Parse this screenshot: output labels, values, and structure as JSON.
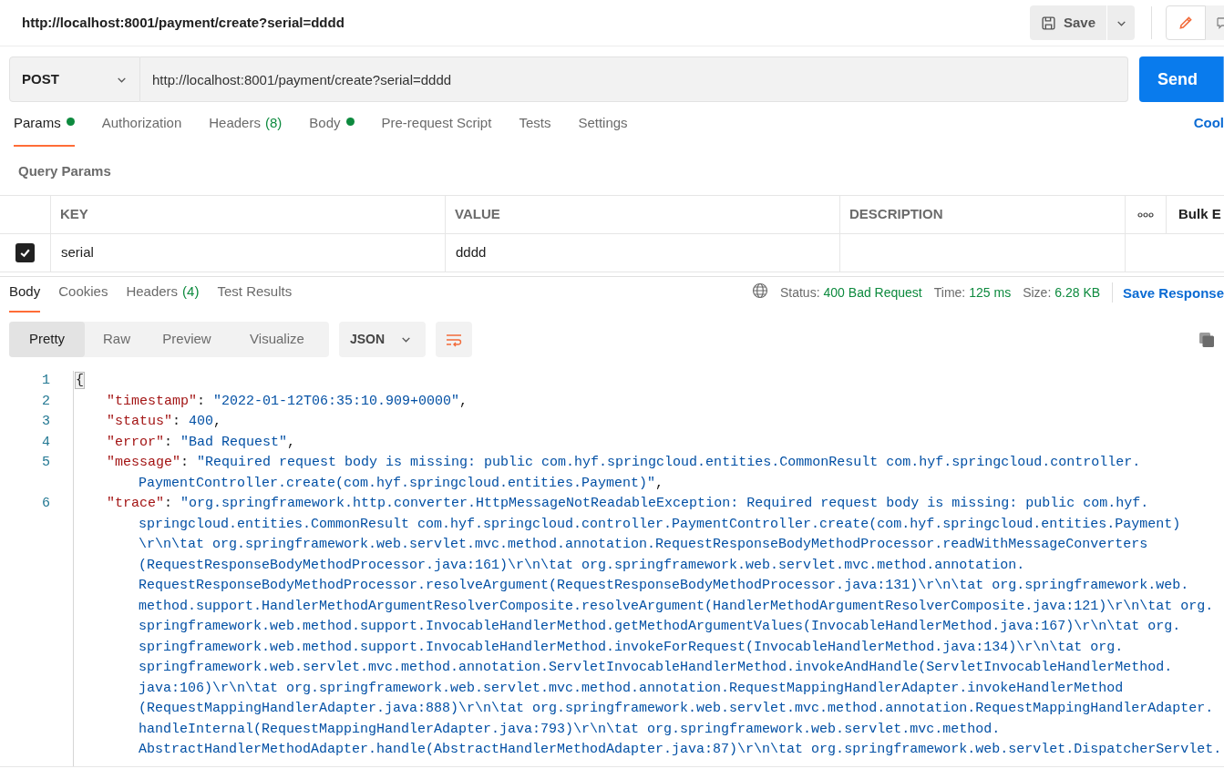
{
  "header": {
    "title": "http://localhost:8001/payment/create?serial=dddd",
    "save_label": "Save"
  },
  "request": {
    "method": "POST",
    "url": "http://localhost:8001/payment/create?serial=dddd",
    "send_label": "Send"
  },
  "request_tabs": [
    {
      "label": "Params",
      "has_content": true,
      "selected": true
    },
    {
      "label": "Authorization",
      "has_content": false,
      "selected": false
    },
    {
      "label": "Headers",
      "count": "(8)",
      "has_content": false,
      "selected": false
    },
    {
      "label": "Body",
      "has_content": true,
      "selected": false
    },
    {
      "label": "Pre-request Script",
      "has_content": false,
      "selected": false
    },
    {
      "label": "Tests",
      "has_content": false,
      "selected": false
    },
    {
      "label": "Settings",
      "has_content": false,
      "selected": false
    }
  ],
  "cookies_link": "Cool",
  "params": {
    "title": "Query Params",
    "columns": [
      "KEY",
      "VALUE",
      "DESCRIPTION"
    ],
    "bulk_edit": "Bulk E",
    "rows": [
      {
        "checked": true,
        "key": "serial",
        "value": "dddd"
      }
    ]
  },
  "response_tabs": [
    {
      "label": "Body",
      "selected": true
    },
    {
      "label": "Cookies",
      "selected": false
    },
    {
      "label": "Headers",
      "count": "(4)",
      "selected": false
    },
    {
      "label": "Test Results",
      "selected": false
    }
  ],
  "response_meta": {
    "status_label": "Status:",
    "status": "400 Bad Request",
    "time_label": "Time:",
    "time": "125 ms",
    "size_label": "Size:",
    "size": "6.28 KB",
    "save_response": "Save Response"
  },
  "view_modes": [
    {
      "label": "Pretty",
      "selected": true
    },
    {
      "label": "Raw",
      "selected": false
    },
    {
      "label": "Preview",
      "selected": false
    },
    {
      "label": "Visualize",
      "selected": false
    }
  ],
  "format": "JSON",
  "body_lines": [
    {
      "number": "1",
      "kind": "brace",
      "tokens": [
        {
          "kind": "punct",
          "text": "{"
        }
      ]
    },
    {
      "number": "2",
      "kind": "entry",
      "tokens": [
        {
          "kind": "key",
          "text": "\"timestamp\""
        },
        {
          "kind": "punct",
          "text": ": "
        },
        {
          "kind": "string",
          "text": "\"2022-01-12T06:35:10.909+0000\""
        },
        {
          "kind": "punct",
          "text": ","
        }
      ]
    },
    {
      "number": "3",
      "kind": "entry",
      "tokens": [
        {
          "kind": "key",
          "text": "\"status\""
        },
        {
          "kind": "punct",
          "text": ": "
        },
        {
          "kind": "number",
          "text": "400"
        },
        {
          "kind": "punct",
          "text": ","
        }
      ]
    },
    {
      "number": "4",
      "kind": "entry",
      "tokens": [
        {
          "kind": "key",
          "text": "\"error\""
        },
        {
          "kind": "punct",
          "text": ": "
        },
        {
          "kind": "string",
          "text": "\"Bad Request\""
        },
        {
          "kind": "punct",
          "text": ","
        }
      ]
    },
    {
      "number": "5",
      "kind": "entry",
      "tokens": [
        {
          "kind": "key",
          "text": "\"message\""
        },
        {
          "kind": "punct",
          "text": ": "
        },
        {
          "kind": "string",
          "text": "\"Required request body is missing: public com.hyf.springcloud.entities.CommonResult com.hyf.springcloud.controller."
        }
      ]
    },
    {
      "kind": "wrap",
      "tokens": [
        {
          "kind": "string",
          "text": "PaymentController.create(com.hyf.springcloud.entities.Payment)\""
        },
        {
          "kind": "punct",
          "text": ","
        }
      ]
    },
    {
      "number": "6",
      "kind": "entry",
      "tokens": [
        {
          "kind": "key",
          "text": "\"trace\""
        },
        {
          "kind": "punct",
          "text": ": "
        },
        {
          "kind": "string",
          "text": "\"org.springframework.http.converter.HttpMessageNotReadableException: Required request body is missing: public com.hyf."
        }
      ]
    },
    {
      "kind": "wrap",
      "tokens": [
        {
          "kind": "string",
          "text": "springcloud.entities.CommonResult com.hyf.springcloud.controller.PaymentController.create(com.hyf.springcloud.entities.Payment)"
        }
      ]
    },
    {
      "kind": "wrap",
      "tokens": [
        {
          "kind": "string",
          "text": "\\r\\n\\tat org.springframework.web.servlet.mvc.method.annotation.RequestResponseBodyMethodProcessor.readWithMessageConverters"
        }
      ]
    },
    {
      "kind": "wrap",
      "tokens": [
        {
          "kind": "string",
          "text": "(RequestResponseBodyMethodProcessor.java:161)\\r\\n\\tat org.springframework.web.servlet.mvc.method.annotation."
        }
      ]
    },
    {
      "kind": "wrap",
      "tokens": [
        {
          "kind": "string",
          "text": "RequestResponseBodyMethodProcessor.resolveArgument(RequestResponseBodyMethodProcessor.java:131)\\r\\n\\tat org.springframework.web."
        }
      ]
    },
    {
      "kind": "wrap",
      "tokens": [
        {
          "kind": "string",
          "text": "method.support.HandlerMethodArgumentResolverComposite.resolveArgument(HandlerMethodArgumentResolverComposite.java:121)\\r\\n\\tat org."
        }
      ]
    },
    {
      "kind": "wrap",
      "tokens": [
        {
          "kind": "string",
          "text": "springframework.web.method.support.InvocableHandlerMethod.getMethodArgumentValues(InvocableHandlerMethod.java:167)\\r\\n\\tat org."
        }
      ]
    },
    {
      "kind": "wrap",
      "tokens": [
        {
          "kind": "string",
          "text": "springframework.web.method.support.InvocableHandlerMethod.invokeForRequest(InvocableHandlerMethod.java:134)\\r\\n\\tat org."
        }
      ]
    },
    {
      "kind": "wrap",
      "tokens": [
        {
          "kind": "string",
          "text": "springframework.web.servlet.mvc.method.annotation.ServletInvocableHandlerMethod.invokeAndHandle(ServletInvocableHandlerMethod."
        }
      ]
    },
    {
      "kind": "wrap",
      "tokens": [
        {
          "kind": "string",
          "text": "java:106)\\r\\n\\tat org.springframework.web.servlet.mvc.method.annotation.RequestMappingHandlerAdapter.invokeHandlerMethod"
        }
      ]
    },
    {
      "kind": "wrap",
      "tokens": [
        {
          "kind": "string",
          "text": "(RequestMappingHandlerAdapter.java:888)\\r\\n\\tat org.springframework.web.servlet.mvc.method.annotation.RequestMappingHandlerAdapter."
        }
      ]
    },
    {
      "kind": "wrap",
      "tokens": [
        {
          "kind": "string",
          "text": "handleInternal(RequestMappingHandlerAdapter.java:793)\\r\\n\\tat org.springframework.web.servlet.mvc.method."
        }
      ]
    },
    {
      "kind": "wrap",
      "tokens": [
        {
          "kind": "string",
          "text": "AbstractHandlerMethodAdapter.handle(AbstractHandlerMethodAdapter.java:87)\\r\\n\\tat org.springframework.web.servlet.DispatcherServlet."
        }
      ]
    }
  ]
}
